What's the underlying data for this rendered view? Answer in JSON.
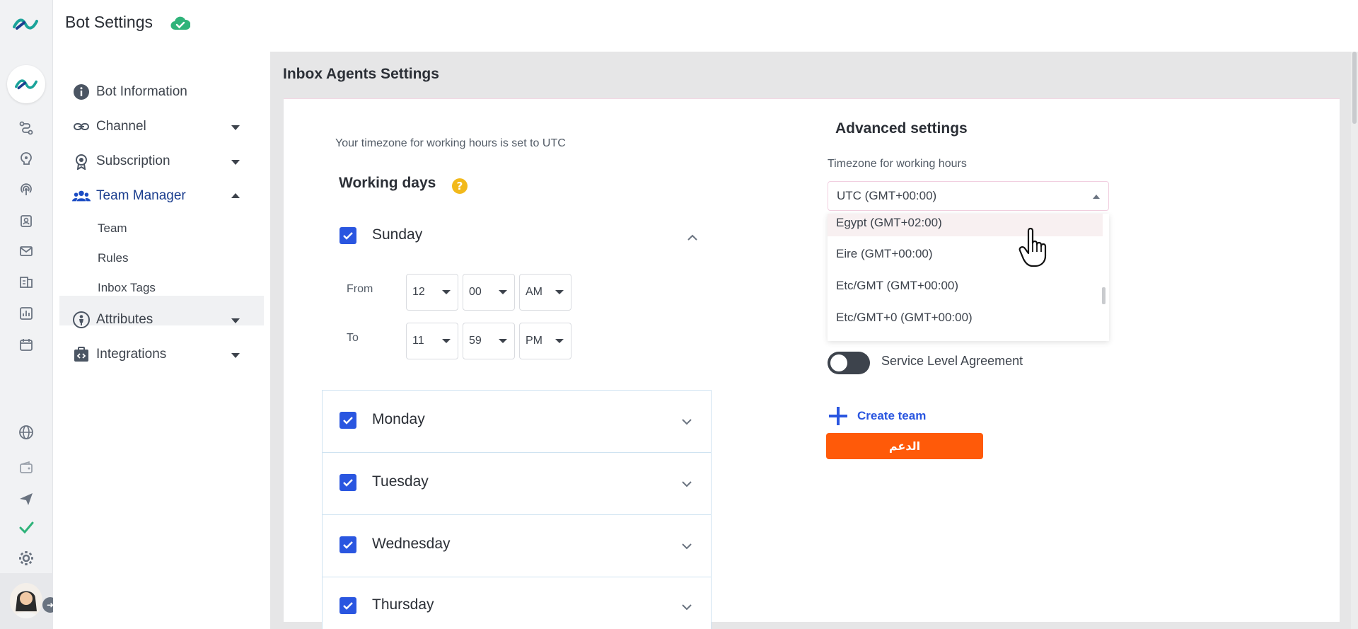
{
  "header": {
    "title": "Bot Settings",
    "status_icon": "cloud-check-icon",
    "status_color": "#2fb37a"
  },
  "rail": {
    "icons": [
      "logo-icon",
      "bot-avatar-icon",
      "flow-icon",
      "brain-icon",
      "broadcast-icon",
      "contacts-icon",
      "mail-icon",
      "store-icon",
      "analytics-icon",
      "calendar-icon",
      "globe-icon",
      "wallet-icon",
      "send-icon",
      "check-icon",
      "gear-icon"
    ]
  },
  "sidebar": {
    "items": [
      {
        "label": "Bot Information",
        "icon": "info-icon"
      },
      {
        "label": "Channel",
        "icon": "link-icon"
      },
      {
        "label": "Subscription",
        "icon": "badge-icon"
      },
      {
        "label": "Team Manager",
        "icon": "team-icon"
      },
      {
        "label": "Attributes",
        "icon": "person-icon"
      },
      {
        "label": "Integrations",
        "icon": "integrations-icon"
      }
    ],
    "sub_items": [
      {
        "label": "Team"
      },
      {
        "label": "Rules"
      },
      {
        "label": "Inbox Tags"
      }
    ],
    "active_sub": "Rules"
  },
  "main": {
    "section_title": "Inbox Agents Settings",
    "timezone_note": "Your timezone for working hours is set to UTC",
    "working_days_title": "Working days",
    "help_glyph": "?",
    "days": [
      {
        "label": "Sunday",
        "checked": true,
        "expanded": true
      },
      {
        "label": "Monday",
        "checked": true,
        "expanded": false
      },
      {
        "label": "Tuesday",
        "checked": true,
        "expanded": false
      },
      {
        "label": "Wednesday",
        "checked": true,
        "expanded": false
      },
      {
        "label": "Thursday",
        "checked": true,
        "expanded": false
      }
    ],
    "sunday_hours": {
      "from_label": "From",
      "to_label": "To",
      "from": {
        "hour": "12",
        "minute": "00",
        "period": "AM"
      },
      "to": {
        "hour": "11",
        "minute": "59",
        "period": "PM"
      }
    }
  },
  "advanced": {
    "title": "Advanced settings",
    "timezone_label": "Timezone for working hours",
    "timezone_value": "UTC (GMT+00:00)",
    "timezone_options": [
      "Egypt (GMT+02:00)",
      "Eire (GMT+00:00)",
      "Etc/GMT (GMT+00:00)",
      "Etc/GMT+0 (GMT+00:00)"
    ],
    "hovered_option": "Egypt (GMT+02:00)",
    "sla_label": "Service Level Agreement",
    "sla_enabled": false,
    "create_team_label": "Create team",
    "support_button_label": "الدعم"
  },
  "colors": {
    "accent": "#2a56e0",
    "support": "#ff5a09",
    "help": "#f2b91b"
  }
}
